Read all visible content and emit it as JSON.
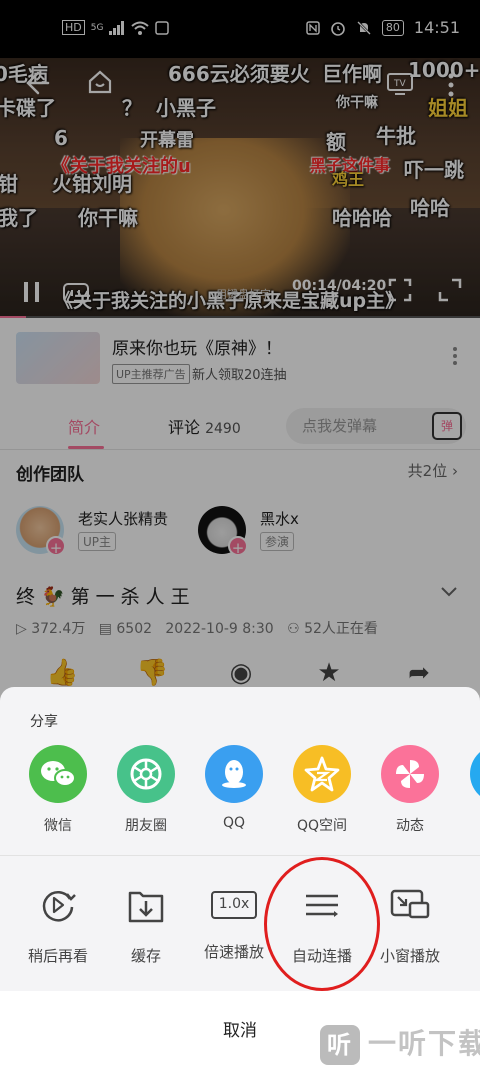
{
  "status_bar": {
    "left_icons": [
      "HD",
      "5G",
      "signal-icon",
      "wifi-icon",
      "app-icon"
    ],
    "right_icons": [
      "nfc-icon",
      "alarm-icon",
      "mute-icon"
    ],
    "battery": "80",
    "time": "14:51"
  },
  "video": {
    "danmaku": [
      {
        "text": "0毛病",
        "color": "white"
      },
      {
        "text": "666云必须要火",
        "color": "white"
      },
      {
        "text": "巨作啊",
        "color": "white"
      },
      {
        "text": "1000+",
        "color": "white"
      },
      {
        "text": "卡碟了",
        "color": "white"
      },
      {
        "text": "？",
        "color": "white"
      },
      {
        "text": "小黑子",
        "color": "white"
      },
      {
        "text": "你干嘛",
        "color": "white"
      },
      {
        "text": "姐姐",
        "color": "yellow"
      },
      {
        "text": "6",
        "color": "white"
      },
      {
        "text": "开幕雷",
        "color": "white"
      },
      {
        "text": "额",
        "color": "white"
      },
      {
        "text": "牛批",
        "color": "white"
      },
      {
        "text": "《关于我关注的u",
        "color": "red"
      },
      {
        "text": "黑子这件事",
        "color": "red"
      },
      {
        "text": "鸡王",
        "color": "yellow"
      },
      {
        "text": "吓一跳",
        "color": "white"
      },
      {
        "text": "钳",
        "color": "white"
      },
      {
        "text": "火钳刘明",
        "color": "white"
      },
      {
        "text": "我了",
        "color": "white"
      },
      {
        "text": "你干嘛",
        "color": "white"
      },
      {
        "text": "哈哈哈",
        "color": "white"
      },
      {
        "text": "哈哈",
        "color": "white"
      },
      {
        "text": "《关于我关注的小黑子原来是宝藏up主》",
        "color": "white"
      }
    ],
    "overlay_text": "用键盘打字",
    "current_time": "00:14",
    "duration": "04:20",
    "time_display": "00:14/04:20",
    "progress_fraction": 0.054
  },
  "ad": {
    "title": "原来你也玩《原神》！",
    "tag": "UP主推荐广告",
    "subtitle": "新人领取20连抽"
  },
  "tabs": {
    "intro": "简介",
    "comments_label": "评论",
    "comments_count": "2490",
    "danmaku_placeholder": "点我发弹幕",
    "danmaku_button": "弹"
  },
  "team": {
    "title": "创作团队",
    "count": "共2位",
    "members": [
      {
        "name": "老实人张精贵",
        "role": "UP主"
      },
      {
        "name": "黑水x",
        "role": "参演"
      }
    ]
  },
  "video_info": {
    "title": "终🐓第一杀人王",
    "views": "372.4万",
    "danmaku_count": "6502",
    "date": "2022-10-9 8:30",
    "watching": "52人正在看"
  },
  "share_sheet": {
    "label": "分享",
    "share_targets": [
      {
        "label": "微信",
        "icon": "wechat-icon",
        "color": "#4dbe4d"
      },
      {
        "label": "朋友圈",
        "icon": "moments-icon",
        "color": "#47c28a"
      },
      {
        "label": "QQ",
        "icon": "qq-icon",
        "color": "#3a9ff0"
      },
      {
        "label": "QQ空间",
        "icon": "qzone-icon",
        "color": "#f7be25"
      },
      {
        "label": "动态",
        "icon": "pinwheel-icon",
        "color": "#fb7299"
      }
    ],
    "tools": [
      {
        "label": "稍后再看",
        "icon": "watch-later-icon"
      },
      {
        "label": "缓存",
        "icon": "download-folder-icon"
      },
      {
        "label": "倍速播放",
        "icon": "speed-icon",
        "icon_text": "1.0x"
      },
      {
        "label": "自动连播",
        "icon": "autoplay-list-icon"
      },
      {
        "label": "小窗播放",
        "icon": "pip-icon"
      }
    ],
    "cancel": "取消"
  },
  "watermark": {
    "glyph": "听",
    "text": "一听下载"
  }
}
